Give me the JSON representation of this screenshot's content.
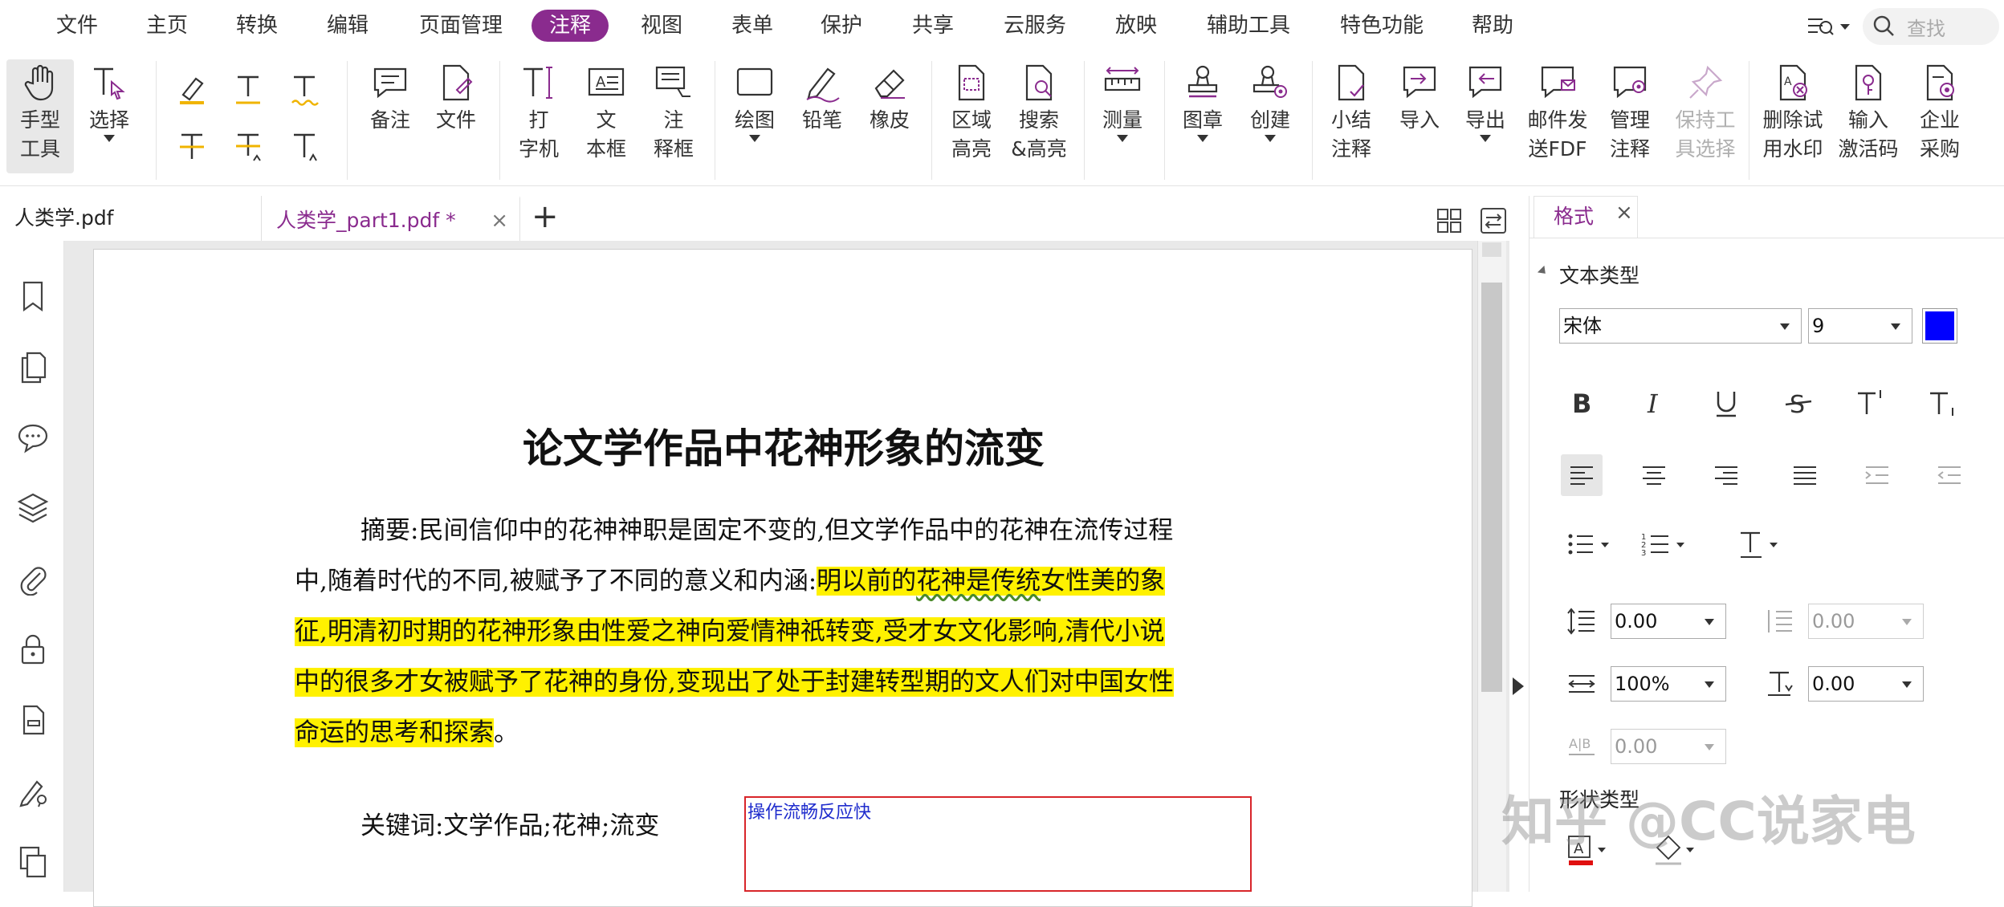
{
  "menu": {
    "items": [
      "文件",
      "主页",
      "转换",
      "编辑",
      "页面管理",
      "注释",
      "视图",
      "表单",
      "保护",
      "共享",
      "云服务",
      "放映",
      "辅助工具",
      "特色功能",
      "帮助"
    ],
    "active": "注释",
    "search_placeholder": "查找"
  },
  "ribbon": {
    "hand": [
      "手型",
      "工具"
    ],
    "select": "选择",
    "note": "备注",
    "file": "文件",
    "typewriter": [
      "打",
      "字机"
    ],
    "textbox": [
      "文",
      "本框"
    ],
    "callout": [
      "注",
      "释框"
    ],
    "drawing": "绘图",
    "pencil": "铅笔",
    "eraser": "橡皮",
    "area_highlight": [
      "区域",
      "高亮"
    ],
    "search_highlight": [
      "搜索",
      "&高亮"
    ],
    "measure": "测量",
    "stamp": "图章",
    "create": "创建",
    "summary": [
      "小结",
      "注释"
    ],
    "import": "导入",
    "export": "导出",
    "email_fdf": [
      "邮件发",
      "送FDF"
    ],
    "manage": [
      "管理",
      "注释"
    ],
    "keep_tool": [
      "保持工",
      "具选择"
    ],
    "remove_watermark": [
      "删除试",
      "用水印"
    ],
    "activation": [
      "输入",
      "激活码"
    ],
    "enterprise": [
      "企业",
      "采购"
    ]
  },
  "tabs": [
    {
      "label": "人类学.pdf",
      "active": false
    },
    {
      "label": "人类学_part1.pdf *",
      "active": true
    }
  ],
  "document": {
    "title": "论文学作品中花神形象的流变",
    "line1": "摘要:民间信仰中的花神神职是固定不变的,但文学作品中的花神在流传过程",
    "line2_plain": "中,随着时代的不同,被赋予了不同的意义和内涵:",
    "line2_hl_a": "明以前的",
    "line2_hl_squiggle": "花神是传统",
    "line2_hl_b": "女性美的象",
    "line3": "征,明清初时期的花神形象由性爱之神向爱情神祇转变,受才女文化影响,清代小说",
    "line4": "中的很多才女被赋予了花神的身份,变现出了处于封建转型期的文人们对中国女性",
    "line5_hl": "命运的思考和探索",
    "line5_end": "。",
    "keywords": "关键词:文学作品;花神;流变",
    "annotation": "操作流畅反应快"
  },
  "format_panel": {
    "tab": "格式",
    "section_text": "文本类型",
    "font": "宋体",
    "size": "9",
    "text_color": "#0000ff",
    "line_spacing": "0.00",
    "para_spacing": "0.00",
    "horizontal_scale": "100%",
    "baseline": "0.00",
    "char_spacing": "0.00",
    "section_shape": "形状类型"
  },
  "watermark": "知乎 @CC说家电"
}
